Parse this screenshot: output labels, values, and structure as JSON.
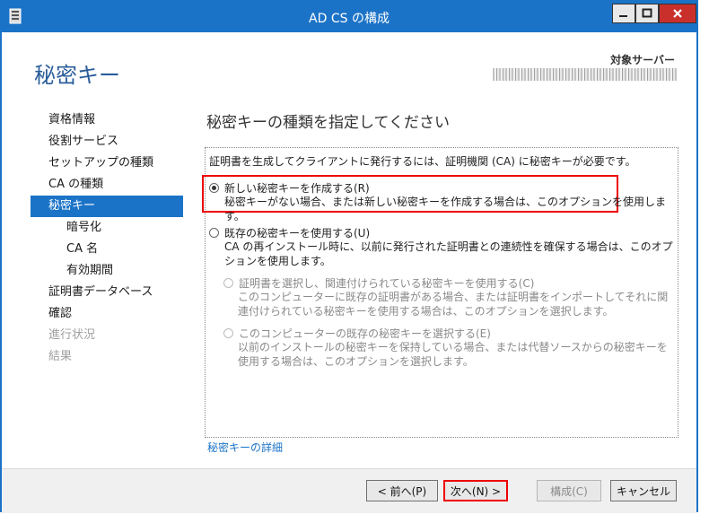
{
  "window": {
    "title": "AD CS の構成"
  },
  "header": {
    "title": "秘密キー",
    "target_label": "対象サーバー"
  },
  "nav": {
    "items": [
      {
        "label": "資格情報",
        "state": "normal"
      },
      {
        "label": "役割サービス",
        "state": "normal"
      },
      {
        "label": "セットアップの種類",
        "state": "normal"
      },
      {
        "label": "CA の種類",
        "state": "normal"
      },
      {
        "label": "秘密キー",
        "state": "active"
      },
      {
        "label": "暗号化",
        "state": "sub"
      },
      {
        "label": "CA 名",
        "state": "sub"
      },
      {
        "label": "有効期間",
        "state": "sub"
      },
      {
        "label": "証明書データベース",
        "state": "normal"
      },
      {
        "label": "確認",
        "state": "normal"
      },
      {
        "label": "進行状況",
        "state": "disabled"
      },
      {
        "label": "結果",
        "state": "disabled"
      }
    ]
  },
  "main": {
    "title": "秘密キーの種類を指定してください",
    "description": "証明書を生成してクライアントに発行するには、証明機関 (CA) に秘密キーが必要です。",
    "option_new": {
      "label": "新しい秘密キーを作成する(R)",
      "desc": "秘密キーがない場合、または新しい秘密キーを作成する場合は、このオプションを使用します。",
      "checked": true
    },
    "option_existing": {
      "label": "既存の秘密キーを使用する(U)",
      "desc": "CA の再インストール時に、以前に発行された証明書との連続性を確保する場合は、このオプションを使用します。",
      "checked": false
    },
    "sub_option_cert": {
      "label": "証明書を選択し、関連付けられている秘密キーを使用する(C)",
      "desc": "このコンピューターに既存の証明書がある場合、または証明書をインポートしてそれに関連付けられている秘密キーを使用する場合は、このオプションを選択します。"
    },
    "sub_option_key": {
      "label": "このコンピューターの既存の秘密キーを選択する(E)",
      "desc": "以前のインストールの秘密キーを保持している場合、または代替ソースからの秘密キーを使用する場合は、このオプションを選択します。"
    },
    "more_link": "秘密キーの詳細"
  },
  "footer": {
    "prev": "< 前へ(P)",
    "next": "次へ(N) >",
    "configure": "構成(C)",
    "cancel": "キャンセル"
  },
  "colors": {
    "accent": "#1b73c7",
    "highlight": "#e00000",
    "close": "#c9302c"
  }
}
